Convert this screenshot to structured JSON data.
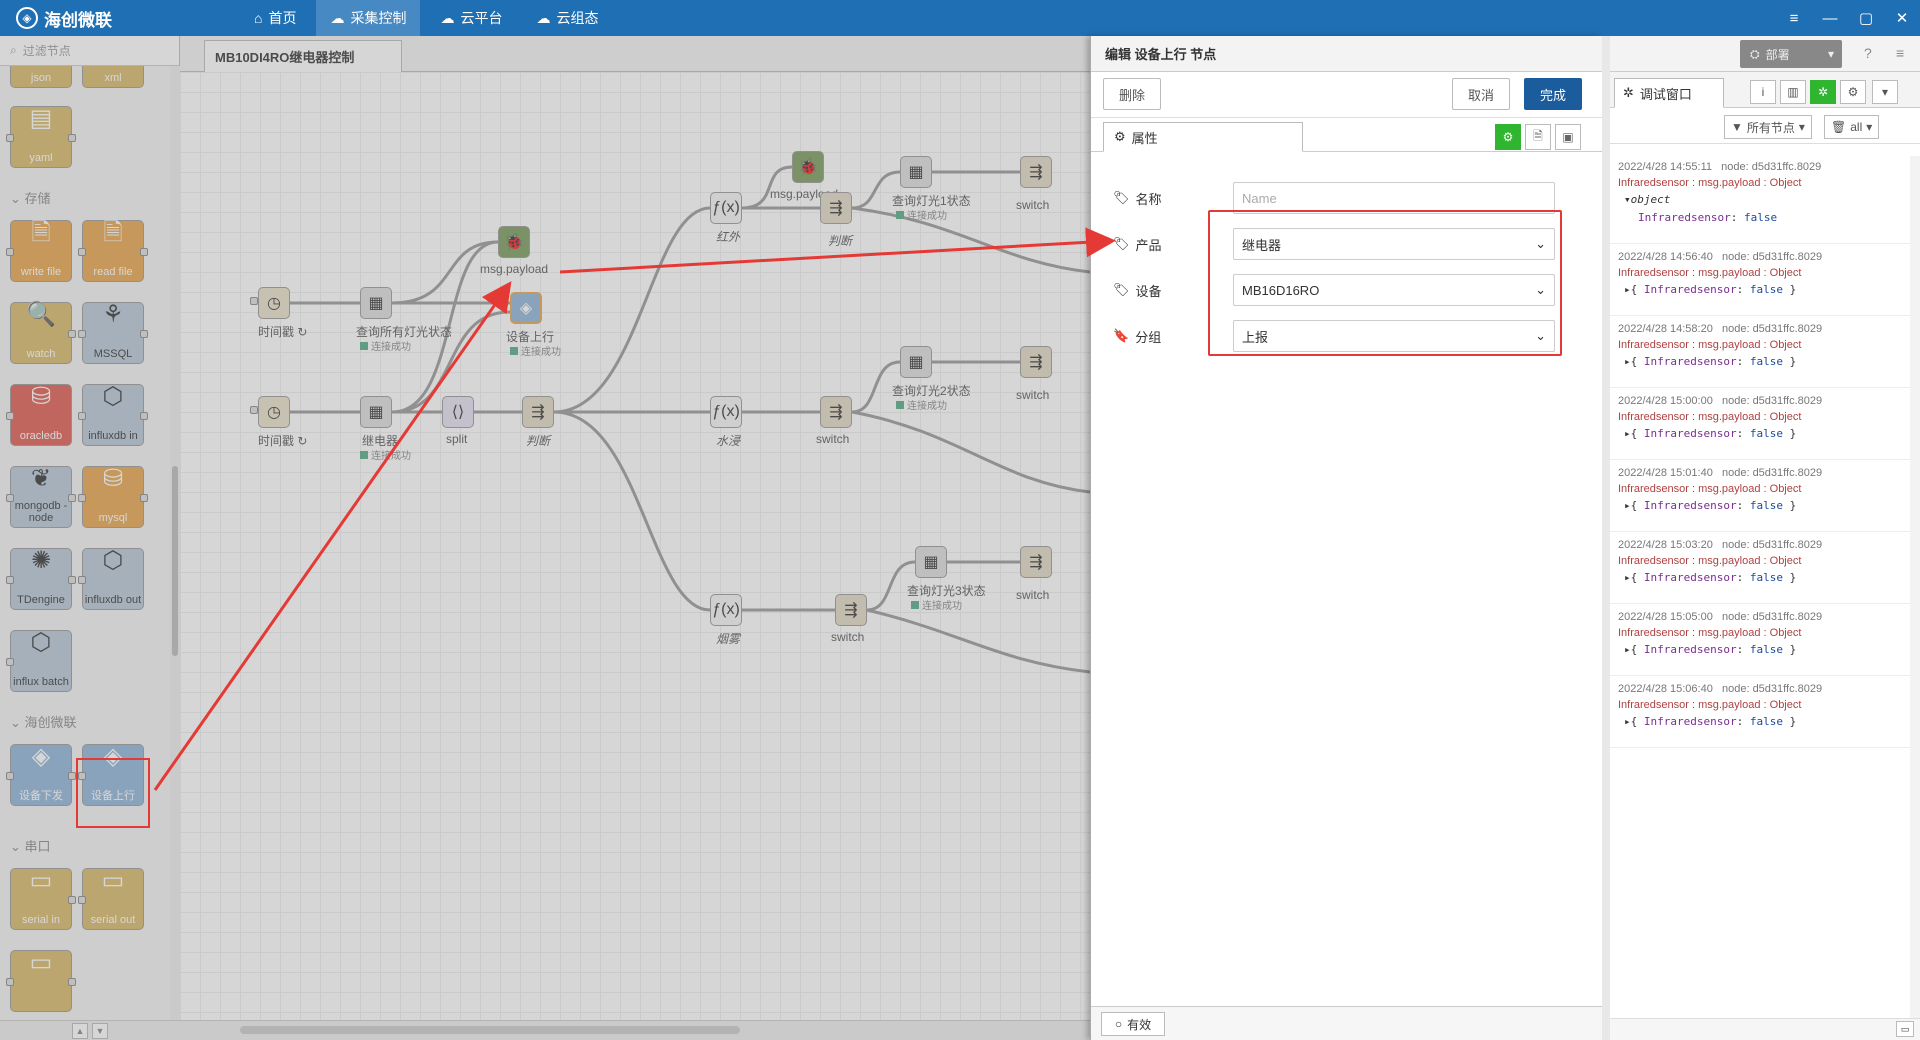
{
  "app": {
    "brand": "海创微联",
    "nav": [
      {
        "label": "首页",
        "icon": "home-icon"
      },
      {
        "label": "采集控制",
        "icon": "cloud-control-icon",
        "active": true
      },
      {
        "label": "云平台",
        "icon": "cloud-platform-icon"
      },
      {
        "label": "云组态",
        "icon": "cloud-config-icon"
      }
    ]
  },
  "palette": {
    "search_placeholder": "过滤节点",
    "top_nodes": [
      "json",
      "xml",
      "yaml"
    ],
    "categories": {
      "storage": "存储",
      "haichuang": "海创微联",
      "serial": "串口"
    },
    "storage_nodes": [
      "write file",
      "read file",
      "watch",
      "MSSQL",
      "oracledb",
      "influxdb in",
      "mongodb - node",
      "mysql",
      "TDengine",
      "influxdb out",
      "influx batch"
    ],
    "haichuang_nodes": [
      "设备下发",
      "设备上行"
    ],
    "serial_nodes": [
      "serial in",
      "serial out"
    ]
  },
  "workspace": {
    "tab": "MB10DI4RO继电器控制",
    "nodes": {
      "ts1": "时间戳 ↻",
      "ts2": "时间戳 ↻",
      "q_all": "查询所有灯光状态",
      "relay": "继电器",
      "debug1": "msg.payload",
      "debug2": "msg.payload",
      "upstream": "设备上行",
      "split": "split",
      "judge_main": "判断",
      "f_infrared": "红外",
      "f_water": "水浸",
      "f_smoke": "烟雾",
      "judge2": "判断",
      "switch_w": "switch",
      "switch_s": "switch",
      "q1": "查询灯光1状态",
      "q2": "查询灯光2状态",
      "q3": "查询灯光3状态",
      "sw1": "switch",
      "sw2": "switch",
      "sw3": "switch",
      "status_ok": "连接成功"
    }
  },
  "editor": {
    "title": "编辑 设备上行 节点",
    "delete": "删除",
    "cancel": "取消",
    "done": "完成",
    "tab": "属性",
    "fields": {
      "name_label": "名称",
      "name_placeholder": "Name",
      "product_label": "产品",
      "product_value": "继电器",
      "device_label": "设备",
      "device_value": "MB16D16RO",
      "group_label": "分组",
      "group_value": "上报"
    },
    "enabled": "有效"
  },
  "sidebar": {
    "deploy": "部署",
    "tab": "调试窗口",
    "filter_nodes": "所有节点",
    "filter_all": "all",
    "messages": [
      {
        "time": "2022/4/28 14:55:11",
        "node": "node: d5d31ffc.8029",
        "topic": "Infraredsensor : msg.payload : Object",
        "type": "object",
        "key": "Infraredsensor",
        "value": "false",
        "expanded": true
      },
      {
        "time": "2022/4/28 14:56:40",
        "node": "node: d5d31ffc.8029",
        "topic": "Infraredsensor : msg.payload : Object",
        "key": "Infraredsensor",
        "value": "false"
      },
      {
        "time": "2022/4/28 14:58:20",
        "node": "node: d5d31ffc.8029",
        "topic": "Infraredsensor : msg.payload : Object",
        "key": "Infraredsensor",
        "value": "false"
      },
      {
        "time": "2022/4/28 15:00:00",
        "node": "node: d5d31ffc.8029",
        "topic": "Infraredsensor : msg.payload : Object",
        "key": "Infraredsensor",
        "value": "false"
      },
      {
        "time": "2022/4/28 15:01:40",
        "node": "node: d5d31ffc.8029",
        "topic": "Infraredsensor : msg.payload : Object",
        "key": "Infraredsensor",
        "value": "false"
      },
      {
        "time": "2022/4/28 15:03:20",
        "node": "node: d5d31ffc.8029",
        "topic": "Infraredsensor : msg.payload : Object",
        "key": "Infraredsensor",
        "value": "false"
      },
      {
        "time": "2022/4/28 15:05:00",
        "node": "node: d5d31ffc.8029",
        "topic": "Infraredsensor : msg.payload : Object",
        "key": "Infraredsensor",
        "value": "false"
      },
      {
        "time": "2022/4/28 15:06:40",
        "node": "node: d5d31ffc.8029",
        "topic": "Infraredsensor : msg.payload : Object",
        "key": "Infraredsensor",
        "value": "false"
      }
    ]
  },
  "colors": {
    "topbar": "#1f6fb5",
    "highlight": "#e53935",
    "done": "#1a5c9c",
    "green": "#2fb52f"
  }
}
